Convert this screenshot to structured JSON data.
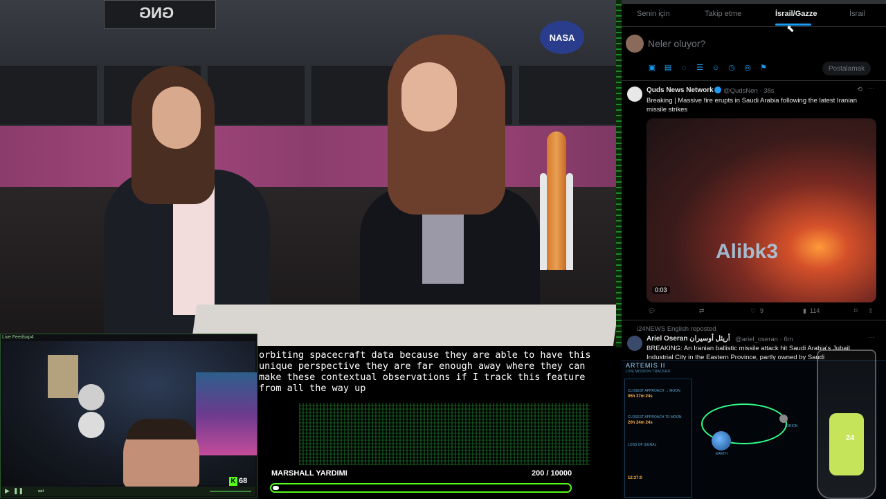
{
  "stream": {
    "video_watermark": "GNG",
    "nasa_logo": "NASA"
  },
  "twitter": {
    "tabs": [
      {
        "label": "Senin için",
        "active": false
      },
      {
        "label": "Takip etme",
        "active": false
      },
      {
        "label": "İsrail/Gazze",
        "active": true
      },
      {
        "label": "İsrail",
        "active": false
      }
    ],
    "compose_placeholder": "Neler oluyor?",
    "post_button": "Postalamak",
    "compose_icons": [
      "image-icon",
      "gif-icon",
      "grok-icon",
      "list-icon",
      "emoji-icon",
      "schedule-icon",
      "location-icon",
      "flag-icon"
    ],
    "tweet1": {
      "name": "Quds News Network",
      "handle": "@QudsNen · 38s",
      "text_line1": "Breaking | Massive fire erupts in Saudi Arabia following the latest Iranian",
      "text_line2": "missile strikes",
      "media_watermark": "Alibk3",
      "duration": "0:03",
      "likes": "9",
      "views": "114"
    },
    "tweet2": {
      "reposted_by": "i24NEWS English reposted",
      "name": "Ariel Oseran أريئل أوسيران",
      "handle": "@ariel_oseran · 6m",
      "text_line1": "BREAKING: An Iranian ballistic missile attack hit Saudi Arabia's Jubail",
      "text_line2": "Industrial City in the Eastern Province, partly owned by Saudi"
    },
    "accent": "#1d9bf0"
  },
  "webcam": {
    "title": "Live Feedsxp4",
    "kick_count": "68",
    "kick_color": "#53fc18"
  },
  "subtitles": {
    "line1": "orbiting spacecraft data because they are able to have this",
    "line2": "unique perspective they are far enough away where they can",
    "line3": "make these contextual observations if I track this feature",
    "line4": "from all the way up"
  },
  "goal": {
    "label": "MARSHALL YARDIMI",
    "count": "200 / 10000",
    "progress": 0.02
  },
  "artemis": {
    "title": "ARTEMIS II",
    "subtitle": "LIVE MISSION TRACKER",
    "items": [
      {
        "label": "CLOSEST APPROACH → MOON",
        "value": "05h 37m 24s"
      },
      {
        "label": "CLOSEST APPROACH TO MOON",
        "value": "20h 24m 24s"
      },
      {
        "label": "LOSS OF SIGNAL",
        "value": "12:37:0"
      }
    ],
    "earth_label": "EARTH",
    "moon_label": "ORION"
  },
  "overlay": {
    "glass_number": "24"
  }
}
